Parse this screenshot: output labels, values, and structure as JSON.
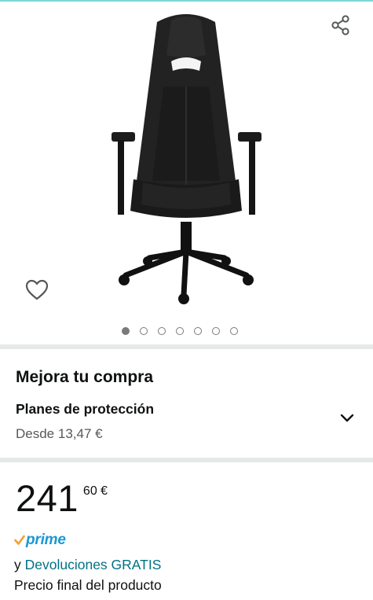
{
  "gallery": {
    "image_alt": "Razer Enki gaming chair",
    "dot_count": 7,
    "active_index": 0
  },
  "upgrade": {
    "title": "Mejora tu compra",
    "plan_title": "Planes de protección",
    "plan_from": "Desde 13,47 €"
  },
  "price": {
    "whole": "241",
    "fraction": "60 €"
  },
  "prime": {
    "label": "prime"
  },
  "returns": {
    "prefix": "y",
    "link": "Devoluciones GRATIS"
  },
  "final_price_note": "Precio final del producto",
  "colors": {
    "link": "#007185",
    "prime_blue": "#1a98d5",
    "prime_check": "#f0a030"
  }
}
